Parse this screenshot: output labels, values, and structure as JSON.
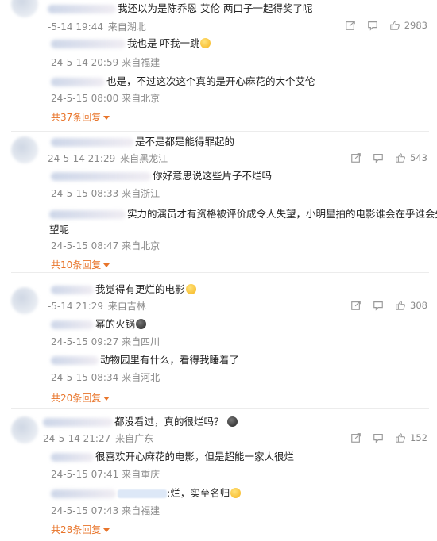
{
  "comments": [
    {
      "text": "我还以为是陈乔恩 艾伦  两口子一起得奖了呢",
      "date": "-5-14 19:44",
      "location": "来自湖北",
      "likes": "2983",
      "replies": [
        {
          "text": "我也是 吓我一跳",
          "emoji": "yellow",
          "date": "24-5-14 20:59",
          "location": "来自福建"
        },
        {
          "text": "也是，不过这次这个真的是开心麻花的大个艾伦",
          "date": "24-5-15 08:00",
          "location": "来自北京"
        }
      ],
      "more_label": "共37条回复"
    },
    {
      "text": "是不是都是能得罪起的",
      "date": "24-5-14 21:29",
      "location": "来自黑龙江",
      "likes": "543",
      "replies": [
        {
          "text": "你好意思说这些片子不烂吗",
          "date": "24-5-15 08:33",
          "location": "来自浙江"
        },
        {
          "text": "实力的演员才有资格被评价成令人失望，小明星拍的电影谁会在乎谁会失",
          "text2": "望呢",
          "date": "24-5-15 08:47",
          "location": "来自北京"
        }
      ],
      "more_label": "共10条回复"
    },
    {
      "text": "我觉得有更烂的电影",
      "emoji": "yellow",
      "date": "-5-14 21:29",
      "location": "来自吉林",
      "likes": "308",
      "replies": [
        {
          "text": "幂的火锅",
          "emoji": "dark",
          "date": "24-5-15 09:27",
          "location": "来自四川"
        },
        {
          "text": "动物园里有什么，看得我睡着了",
          "date": "24-5-15 08:34",
          "location": "来自河北"
        }
      ],
      "more_label": "共20条回复"
    },
    {
      "text": "都没看过，真的很烂吗？",
      "emoji": "dark",
      "date": "24-5-14 21:27",
      "location": "来自广东",
      "likes": "152",
      "replies": [
        {
          "text": "很喜欢开心麻花的电影，但是超能一家人很烂",
          "date": "24-5-15 07:41",
          "location": "来自重庆"
        },
        {
          "text": ":烂，实至名归",
          "emoji": "yellow",
          "chip": true,
          "date": "24-5-15 07:43",
          "location": "来自福建"
        }
      ],
      "more_label": "共28条回复"
    }
  ]
}
